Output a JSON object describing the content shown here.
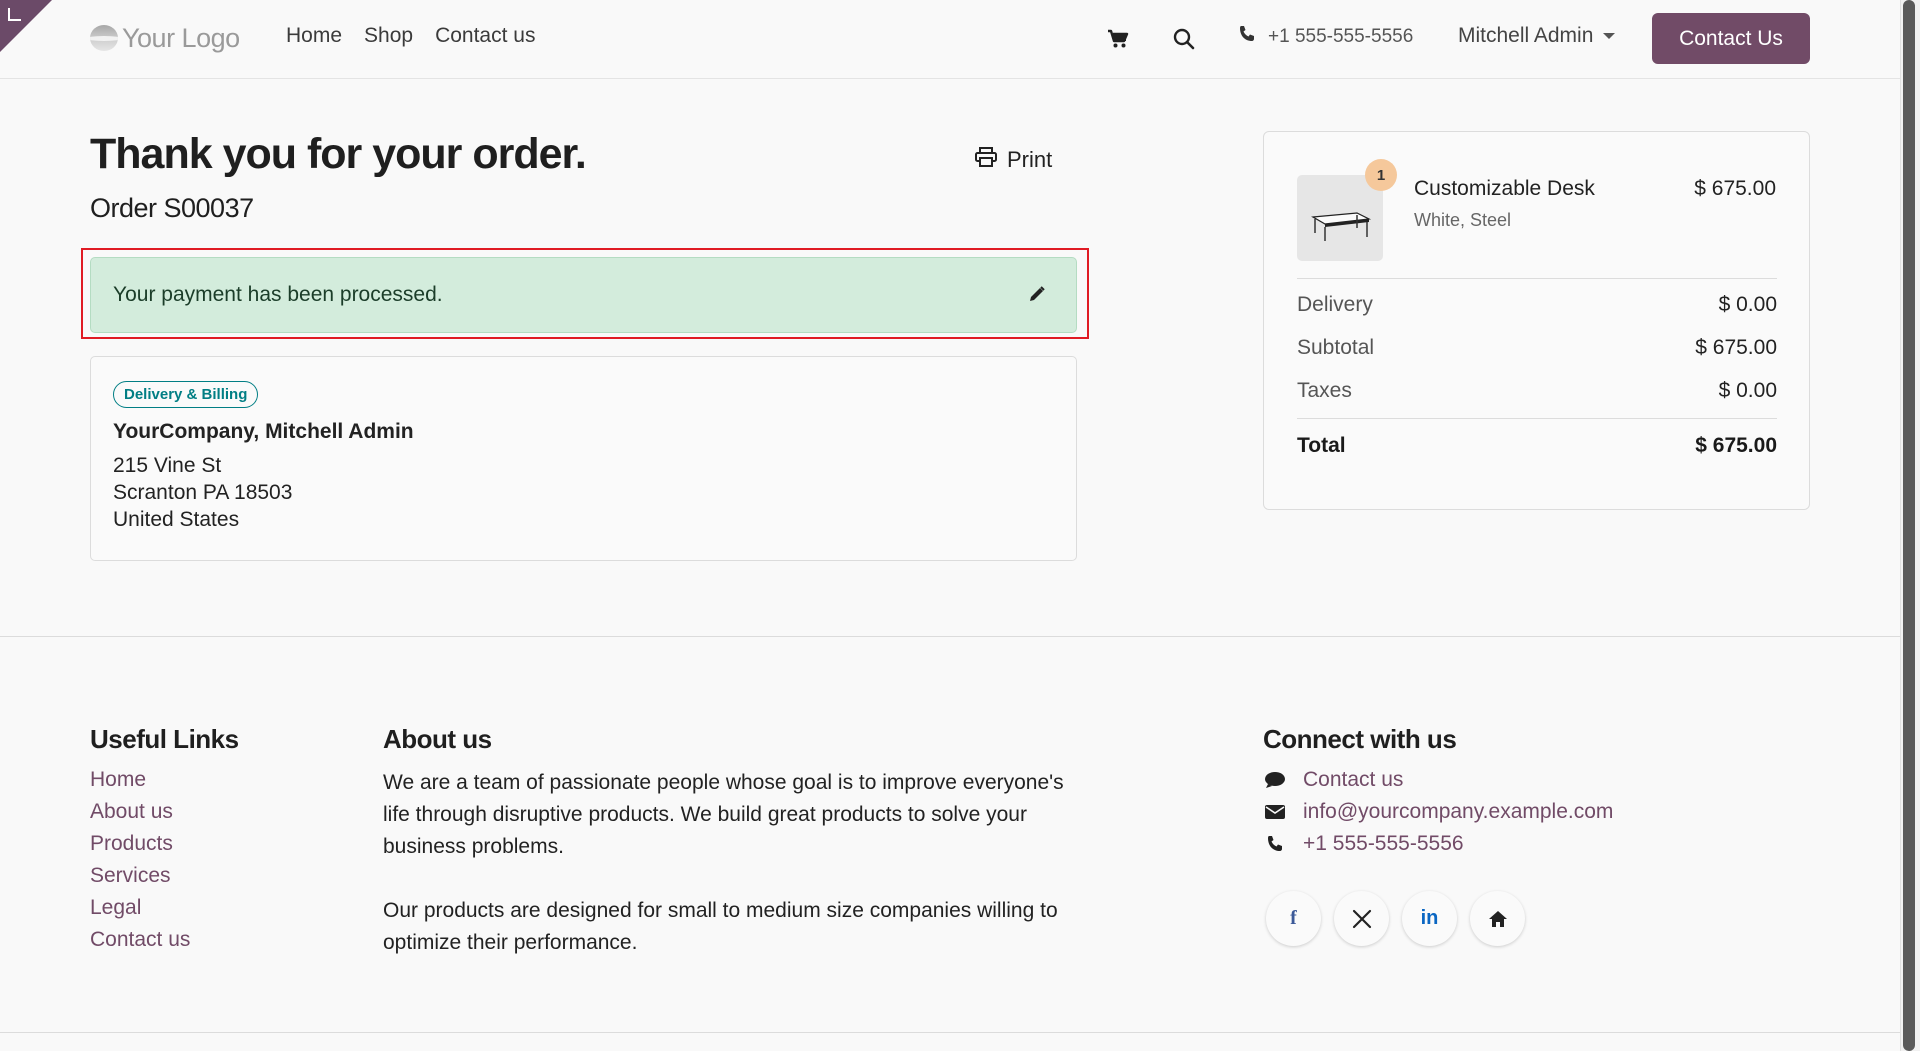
{
  "header": {
    "logo_text": "Your Logo",
    "nav": [
      {
        "label": "Home"
      },
      {
        "label": "Shop"
      },
      {
        "label": "Contact us"
      }
    ],
    "phone": "+1 555-555-5556",
    "user_name": "Mitchell Admin",
    "cta_label": "Contact Us"
  },
  "main": {
    "title": "Thank you for your order.",
    "order_ref": "Order S00037",
    "print_label": "Print",
    "alert_text": "Your payment has been processed.",
    "address": {
      "badge": "Delivery & Billing",
      "name": "YourCompany, Mitchell Admin",
      "lines": [
        "215 Vine St",
        "Scranton PA 18503",
        "United States"
      ]
    }
  },
  "summary": {
    "product": {
      "qty": "1",
      "name": "Customizable Desk",
      "variant": "White, Steel",
      "price": "$ 675.00"
    },
    "rows": [
      {
        "label": "Delivery",
        "value": "$ 0.00"
      },
      {
        "label": "Subtotal",
        "value": "$ 675.00"
      },
      {
        "label": "Taxes",
        "value": "$ 0.00"
      }
    ],
    "total": {
      "label": "Total",
      "value": "$ 675.00"
    }
  },
  "footer": {
    "useful_links_heading": "Useful Links",
    "useful_links": [
      "Home",
      "About us",
      "Products",
      "Services",
      "Legal",
      "Contact us"
    ],
    "about_heading": "About us",
    "about_p1": "We are a team of passionate people whose goal is to improve everyone's life through disruptive products. We build great products to solve your business problems.",
    "about_p2": "Our products are designed for small to medium size companies willing to optimize their performance.",
    "connect_heading": "Connect with us",
    "contact_link": "Contact us",
    "email": "info@yourcompany.example.com",
    "phone": "+1 555-555-5556",
    "socials": [
      {
        "icon": "facebook-icon",
        "glyph": "f",
        "color": "#3b5998"
      },
      {
        "icon": "x-icon",
        "glyph": "𝕏",
        "color": "#222222"
      },
      {
        "icon": "linkedin-icon",
        "glyph": "in",
        "color": "#0a66c2"
      },
      {
        "icon": "home-icon",
        "glyph": "⌂",
        "color": "#222222"
      }
    ]
  },
  "colors": {
    "brand": "#714b67",
    "alert_bg": "#d3ecdc",
    "badge": "#017e84",
    "highlight": "#e01b24"
  }
}
